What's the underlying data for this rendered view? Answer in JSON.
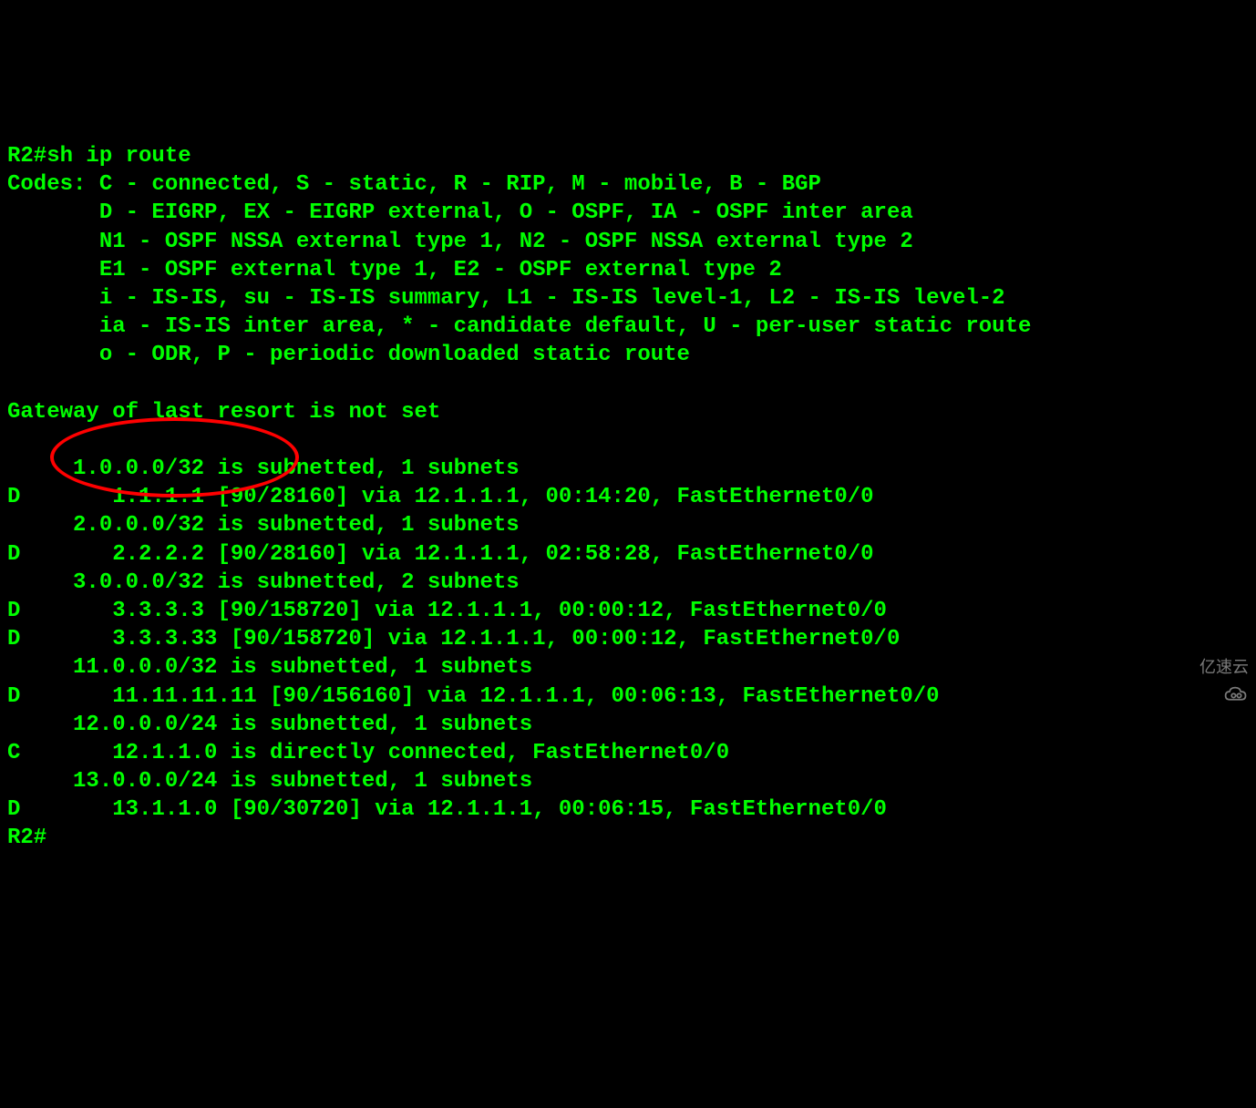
{
  "terminal": {
    "prompt_cmd": "R2#sh ip route",
    "codes_line1": "Codes: C - connected, S - static, R - RIP, M - mobile, B - BGP",
    "codes_line2": "       D - EIGRP, EX - EIGRP external, O - OSPF, IA - OSPF inter area",
    "codes_line3": "       N1 - OSPF NSSA external type 1, N2 - OSPF NSSA external type 2",
    "codes_line4": "       E1 - OSPF external type 1, E2 - OSPF external type 2",
    "codes_line5": "       i - IS-IS, su - IS-IS summary, L1 - IS-IS level-1, L2 - IS-IS level-2",
    "codes_line6": "       ia - IS-IS inter area, * - candidate default, U - per-user static route",
    "codes_line7": "       o - ODR, P - periodic downloaded static route",
    "blank1": "",
    "gateway": "Gateway of last resort is not set",
    "blank2": "",
    "route1_header": "     1.0.0.0/32 is subnetted, 1 subnets",
    "route1_entry": "D       1.1.1.1 [90/28160] via 12.1.1.1, 00:14:20, FastEthernet0/0",
    "route2_header": "     2.0.0.0/32 is subnetted, 1 subnets",
    "route2_entry": "D       2.2.2.2 [90/28160] via 12.1.1.1, 02:58:28, FastEthernet0/0",
    "route3_header": "     3.0.0.0/32 is subnetted, 2 subnets",
    "route3_entry1": "D       3.3.3.3 [90/158720] via 12.1.1.1, 00:00:12, FastEthernet0/0",
    "route3_entry2": "D       3.3.3.33 [90/158720] via 12.1.1.1, 00:00:12, FastEthernet0/0",
    "route11_header": "     11.0.0.0/32 is subnetted, 1 subnets",
    "route11_entry": "D       11.11.11.11 [90/156160] via 12.1.1.1, 00:06:13, FastEthernet0/0",
    "route12_header": "     12.0.0.0/24 is subnetted, 1 subnets",
    "route12_entry": "C       12.1.1.0 is directly connected, FastEthernet0/0",
    "route13_header": "     13.0.0.0/24 is subnetted, 1 subnets",
    "route13_entry": "D       13.1.1.0 [90/30720] via 12.1.1.1, 00:06:15, FastEthernet0/0",
    "prompt_end": "R2#"
  },
  "watermark": {
    "text": "亿速云"
  }
}
